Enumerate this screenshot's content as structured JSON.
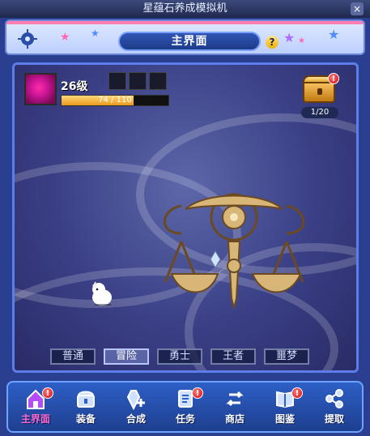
{
  "window": {
    "title": "星蕴石养成模拟机",
    "close_glyph": "×"
  },
  "header": {
    "title": "主界面",
    "help_glyph": "?"
  },
  "player": {
    "level": "26级",
    "xp_text": "74 / 110",
    "xp_fraction": 0.673
  },
  "chest": {
    "count_text": "1/20",
    "alert_glyph": "!"
  },
  "tabs": [
    {
      "label": "普通",
      "active": false
    },
    {
      "label": "冒险",
      "active": true
    },
    {
      "label": "勇士",
      "active": false
    },
    {
      "label": "王者",
      "active": false
    },
    {
      "label": "噩梦",
      "active": false
    }
  ],
  "nav": {
    "items": [
      {
        "label": "主界面",
        "icon": "home-icon",
        "active": true,
        "alert": true
      },
      {
        "label": "装备",
        "icon": "chest-icon",
        "active": false,
        "alert": false
      },
      {
        "label": "合成",
        "icon": "crystal-plus-icon",
        "active": false,
        "alert": false
      },
      {
        "label": "任务",
        "icon": "book-icon",
        "active": false,
        "alert": true
      },
      {
        "label": "商店",
        "icon": "exchange-icon",
        "active": false,
        "alert": false
      },
      {
        "label": "图鉴",
        "icon": "open-book-icon",
        "active": false,
        "alert": true
      },
      {
        "label": "提取",
        "icon": "share-icon",
        "active": false,
        "alert": false
      }
    ],
    "alert_glyph": "!"
  },
  "colors": {
    "accent_pink": "#ff7fb4",
    "panel_blue": "#2a3f8f",
    "active_tab": "#b7c6ff",
    "nav_active": "#ff6bd2"
  }
}
